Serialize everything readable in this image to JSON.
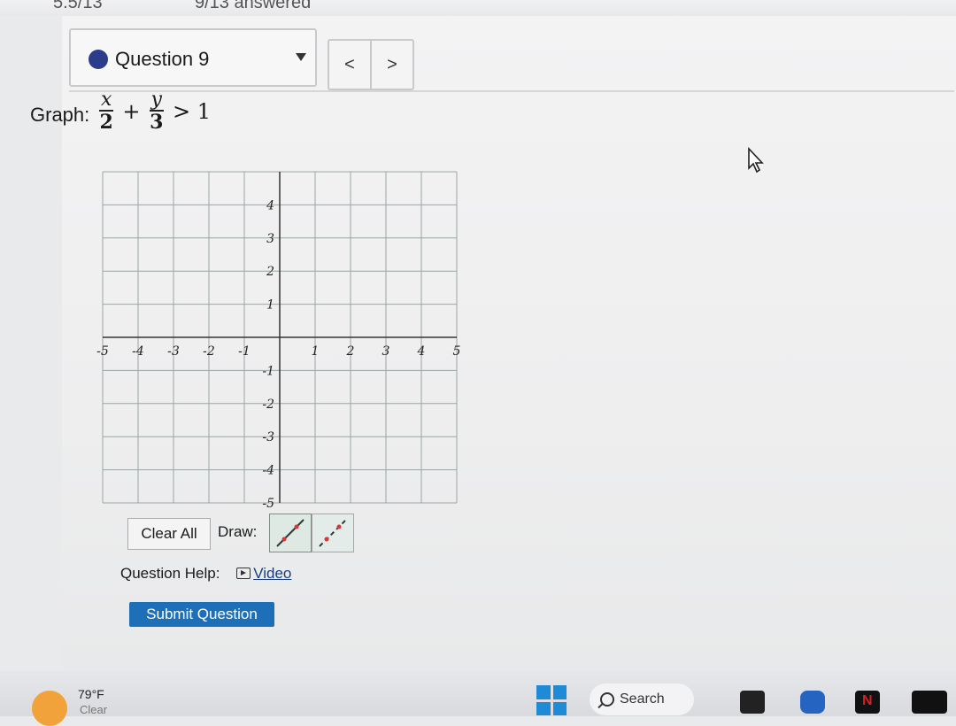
{
  "header": {
    "score": "5.5/13",
    "answered": "9/13 answered"
  },
  "question_nav": {
    "current_label": "Question 9",
    "prev_label": "<",
    "next_label": ">"
  },
  "problem": {
    "prompt": "Graph:",
    "term1_num": "x",
    "term1_den": "2",
    "plus": "+",
    "term2_num": "y",
    "term2_den": "3",
    "relation": "> 1"
  },
  "graph": {
    "x_ticks": [
      "-5",
      "-4",
      "-3",
      "-2",
      "-1",
      "1",
      "2",
      "3",
      "4",
      "5"
    ],
    "y_ticks": [
      "4",
      "3",
      "2",
      "1",
      "-1",
      "-2",
      "-3",
      "-4",
      "-5"
    ],
    "x_range": [
      -5,
      5
    ],
    "y_range": [
      -5,
      5
    ],
    "grid": true
  },
  "tools": {
    "clear_all_label": "Clear All",
    "draw_label": "Draw:",
    "solid_line_tool": "solid-line",
    "dashed_line_tool": "dashed-line"
  },
  "help": {
    "label": "Question Help:",
    "video_label": "Video"
  },
  "submit_label": "Submit Question",
  "taskbar": {
    "temperature": "79°F",
    "condition": "Clear",
    "search_label": "Search"
  },
  "colors": {
    "accent": "#1d6fb8",
    "question_dot": "#2a3c8a",
    "grid": "#9aa6a4"
  }
}
